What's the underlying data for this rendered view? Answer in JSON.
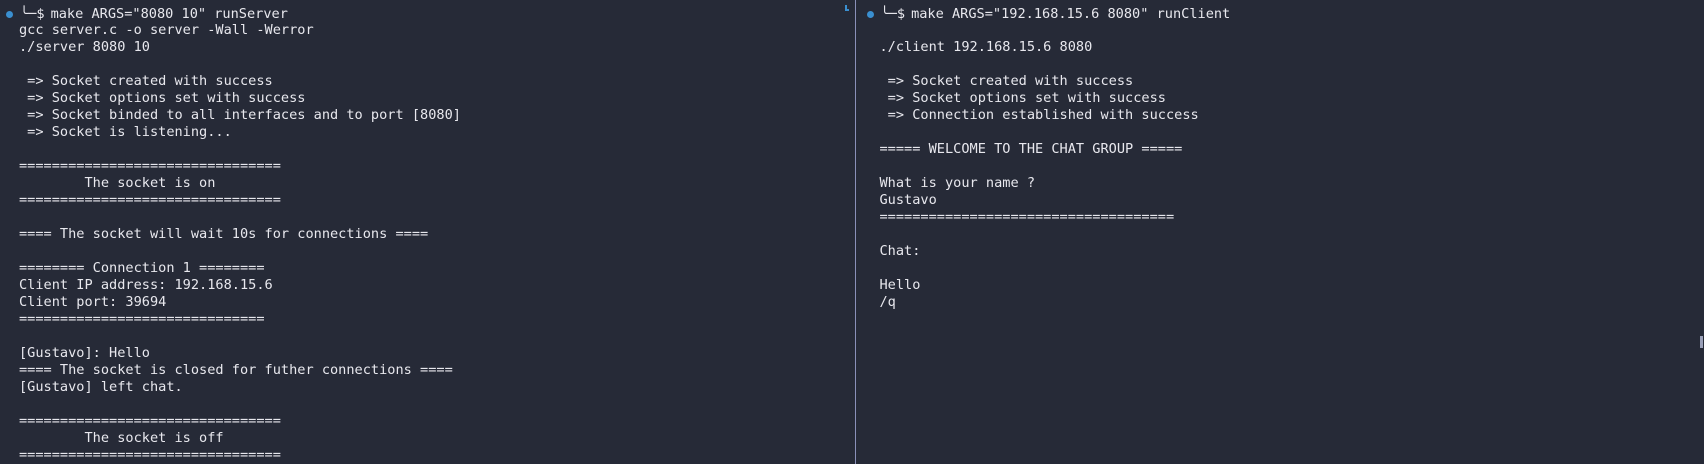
{
  "left_pane": {
    "command": "make ARGS=\"8080 10\" runServer",
    "lines": [
      "gcc server.c -o server -Wall -Werror",
      "./server 8080 10",
      "",
      " => Socket created with success",
      " => Socket options set with success",
      " => Socket binded to all interfaces and to port [8080]",
      " => Socket is listening...",
      "",
      "================================",
      "        The socket is on",
      "================================",
      "",
      "==== The socket will wait 10s for connections ====",
      "",
      "======== Connection 1 ========",
      "Client IP address: 192.168.15.6",
      "Client port: 39694",
      "==============================",
      "",
      "[Gustavo]: Hello",
      "==== The socket is closed for futher connections ====",
      "[Gustavo] left chat.",
      "",
      "================================",
      "        The socket is off",
      "================================"
    ]
  },
  "right_pane": {
    "command": "make ARGS=\"192.168.15.6 8080\" runClient",
    "lines": [
      "./client 192.168.15.6 8080",
      "",
      " => Socket created with success",
      " => Socket options set with success",
      " => Connection established with success",
      "",
      "===== WELCOME TO THE CHAT GROUP =====",
      "",
      "What is your name ?",
      "Gustavo",
      "====================================",
      "",
      "Chat:",
      "",
      "Hello",
      "/q"
    ]
  },
  "colors": {
    "background": "#262a37",
    "text": "#e8e8ee",
    "accent": "#3a8fd0",
    "divider": "#8a90b8"
  },
  "icons": {
    "prompt_marker": "dot-icon",
    "corner_marker": "pane-corner-icon"
  }
}
